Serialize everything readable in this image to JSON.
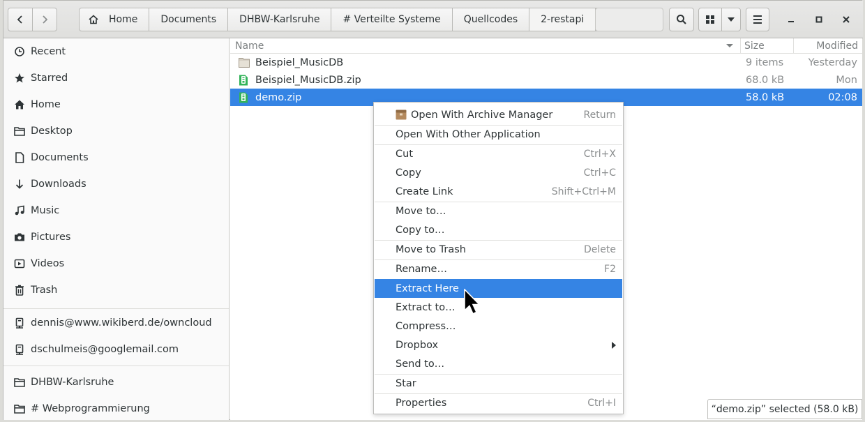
{
  "toolbar": {
    "back_icon": "chevron-left-icon",
    "forward_icon": "chevron-right-icon",
    "breadcrumbs": [
      "Home",
      "Documents",
      "DHBW-Karlsruhe",
      "# Verteilte Systeme",
      "Quellcodes",
      "2-restapi"
    ],
    "search_icon": "search-icon",
    "view_icon": "grid-view-icon",
    "menu_icon": "hamburger-menu-icon",
    "window_controls": [
      "minimize",
      "maximize",
      "close"
    ]
  },
  "sidebar": {
    "items": [
      {
        "label": "Recent",
        "icon": "clock-icon"
      },
      {
        "label": "Starred",
        "icon": "star-icon"
      },
      {
        "label": "Home",
        "icon": "home-icon"
      },
      {
        "label": "Desktop",
        "icon": "folder-icon"
      },
      {
        "label": "Documents",
        "icon": "document-icon"
      },
      {
        "label": "Downloads",
        "icon": "download-icon"
      },
      {
        "label": "Music",
        "icon": "music-icon"
      },
      {
        "label": "Pictures",
        "icon": "camera-icon"
      },
      {
        "label": "Videos",
        "icon": "video-icon"
      },
      {
        "label": "Trash",
        "icon": "trash-icon"
      }
    ],
    "network": [
      {
        "label": "dennis@www.wikiberd.de/owncloud",
        "icon": "network-drive-icon"
      },
      {
        "label": "dschulmeis@googlemail.com",
        "icon": "network-drive-icon"
      }
    ],
    "bookmarks": [
      {
        "label": "DHBW-Karlsruhe",
        "icon": "folder-icon"
      },
      {
        "label": "# Webprogrammierung",
        "icon": "folder-icon"
      }
    ]
  },
  "list": {
    "columns": {
      "name": "Name",
      "size": "Size",
      "modified": "Modified"
    },
    "rows": [
      {
        "name": "Beispiel_MusicDB",
        "size": "9 items",
        "modified": "Yesterday",
        "icon": "folder-icon",
        "selected": false
      },
      {
        "name": "Beispiel_MusicDB.zip",
        "size": "68.0 kB",
        "modified": "Mon",
        "icon": "zip-file-icon",
        "selected": false
      },
      {
        "name": "demo.zip",
        "size": "58.0 kB",
        "modified": "02:08",
        "icon": "zip-file-icon",
        "selected": true
      }
    ]
  },
  "context_menu": {
    "items": [
      {
        "label": "Open With Archive Manager",
        "accel": "Return",
        "icon": "archive-manager-icon"
      },
      {
        "label": "Open With Other Application",
        "accel": ""
      },
      {
        "label": "Cut",
        "accel": "Ctrl+X"
      },
      {
        "label": "Copy",
        "accel": "Ctrl+C"
      },
      {
        "label": "Create Link",
        "accel": "Shift+Ctrl+M"
      },
      {
        "label": "Move to…",
        "accel": ""
      },
      {
        "label": "Copy to…",
        "accel": ""
      },
      {
        "label": "Move to Trash",
        "accel": "Delete"
      },
      {
        "label": "Rename…",
        "accel": "F2"
      },
      {
        "label": "Extract Here",
        "accel": "",
        "highlighted": true
      },
      {
        "label": "Extract to…",
        "accel": ""
      },
      {
        "label": "Compress…",
        "accel": ""
      },
      {
        "label": "Dropbox",
        "accel": "",
        "submenu": true
      },
      {
        "label": "Send to…",
        "accel": ""
      },
      {
        "label": "Star",
        "accel": ""
      },
      {
        "label": "Properties",
        "accel": "Ctrl+I"
      }
    ]
  },
  "status": {
    "text": "“demo.zip” selected  (58.0 kB)"
  },
  "colors": {
    "accent": "#3584e4",
    "zip_green": "#33b35a"
  }
}
